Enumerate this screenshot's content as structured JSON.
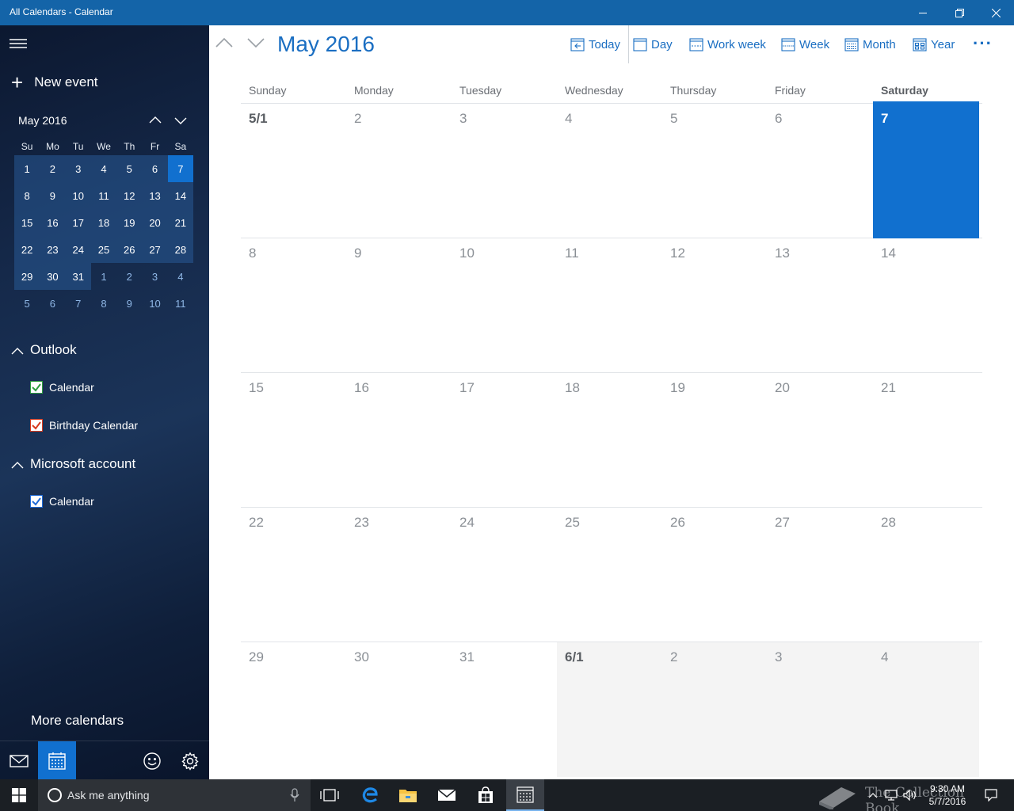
{
  "window": {
    "title": "All Calendars - Calendar"
  },
  "sidebar": {
    "new_event_label": "New event",
    "mini_calendar": {
      "month_label": "May 2016",
      "weekdays": [
        "Su",
        "Mo",
        "Tu",
        "We",
        "Th",
        "Fr",
        "Sa"
      ],
      "weeks": [
        [
          1,
          2,
          3,
          4,
          5,
          6,
          7
        ],
        [
          8,
          9,
          10,
          11,
          12,
          13,
          14
        ],
        [
          15,
          16,
          17,
          18,
          19,
          20,
          21
        ],
        [
          22,
          23,
          24,
          25,
          26,
          27,
          28
        ],
        [
          29,
          30,
          31,
          1,
          2,
          3,
          4
        ],
        [
          5,
          6,
          7,
          8,
          9,
          10,
          11
        ]
      ],
      "selected_day": 7
    },
    "groups": [
      {
        "name": "Outlook",
        "calendars": [
          {
            "name": "Calendar",
            "checked": true,
            "color": "#2e9e3e"
          },
          {
            "name": "Birthday Calendar",
            "checked": true,
            "color": "#d83b1e"
          }
        ]
      },
      {
        "name": "Microsoft account",
        "calendars": [
          {
            "name": "Calendar",
            "checked": true,
            "color": "#1e6ad8"
          }
        ]
      }
    ],
    "more_calendars_label": "More calendars"
  },
  "toolbar": {
    "month_title": "May 2016",
    "today_label": "Today",
    "day_label": "Day",
    "work_week_label": "Work week",
    "week_label": "Week",
    "month_label": "Month",
    "year_label": "Year",
    "more_label": "···"
  },
  "month_view": {
    "weekdays": [
      "Sunday",
      "Monday",
      "Tuesday",
      "Wednesday",
      "Thursday",
      "Friday",
      "Saturday"
    ],
    "weeks": [
      [
        "5/1",
        "2",
        "3",
        "4",
        "5",
        "6",
        "7"
      ],
      [
        "8",
        "9",
        "10",
        "11",
        "12",
        "13",
        "14"
      ],
      [
        "15",
        "16",
        "17",
        "18",
        "19",
        "20",
        "21"
      ],
      [
        "22",
        "23",
        "24",
        "25",
        "26",
        "27",
        "28"
      ],
      [
        "29",
        "30",
        "31",
        "6/1",
        "2",
        "3",
        "4"
      ]
    ],
    "today": "7",
    "accent_color": "#1170cf"
  },
  "taskbar": {
    "search_placeholder": "Ask me anything",
    "time": "9:30 AM",
    "date": "5/7/2016",
    "watermark_text": "The Collection Book"
  }
}
